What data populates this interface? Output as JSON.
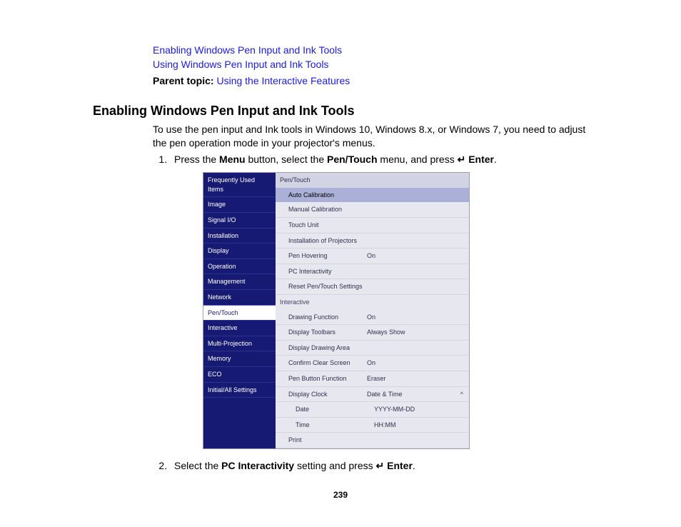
{
  "toc": {
    "link1": "Enabling Windows Pen Input and Ink Tools",
    "link2": "Using Windows Pen Input and Ink Tools",
    "parent_label": "Parent topic:",
    "parent_link": "Using the Interactive Features"
  },
  "section": {
    "title": "Enabling Windows Pen Input and Ink Tools",
    "intro": "To use the pen input and Ink tools in Windows 10, Windows 8.x, or Windows 7, you need to adjust the pen operation mode in your projector's menus."
  },
  "steps": {
    "s1_a": "Press the ",
    "s1_menu": "Menu",
    "s1_b": " button, select the ",
    "s1_pen": "Pen/Touch",
    "s1_c": " menu, and press ",
    "s1_enter": "Enter",
    "s1_d": ".",
    "s2_a": "Select the ",
    "s2_pc": "PC Interactivity",
    "s2_b": " setting and press ",
    "s2_enter": "Enter",
    "s2_c": "."
  },
  "menu": {
    "left": [
      "Frequently Used Items",
      "Image",
      "Signal I/O",
      "Installation",
      "Display",
      "Operation",
      "Management",
      "Network",
      "Pen/Touch",
      "Interactive",
      "Multi-Projection",
      "Memory",
      "ECO",
      "Initial/All Settings"
    ],
    "left_selected": 8,
    "right_header": "Pen/Touch",
    "right_top": [
      {
        "label": "Auto Calibration",
        "val": "",
        "sel": true
      },
      {
        "label": "Manual Calibration",
        "val": ""
      },
      {
        "label": "Touch Unit",
        "val": ""
      },
      {
        "label": "Installation of Projectors",
        "val": ""
      },
      {
        "label": "Pen Hovering",
        "val": "On"
      },
      {
        "label": "PC Interactivity",
        "val": ""
      },
      {
        "label": "Reset Pen/Touch Settings",
        "val": ""
      }
    ],
    "right_group": "Interactive",
    "right_bottom": [
      {
        "label": "Drawing Function",
        "val": "On"
      },
      {
        "label": "Display Toolbars",
        "val": "Always Show"
      },
      {
        "label": "Display Drawing Area",
        "val": ""
      },
      {
        "label": "Confirm Clear Screen",
        "val": "On"
      },
      {
        "label": "Pen Button Function",
        "val": "Eraser"
      },
      {
        "label": "Display Clock",
        "val": "Date & Time",
        "caret": true
      },
      {
        "label": "Date",
        "val": "YYYY-MM-DD",
        "indent": true
      },
      {
        "label": "Time",
        "val": "HH:MM",
        "indent": true
      },
      {
        "label": "Print",
        "val": ""
      }
    ]
  },
  "page_number": "239"
}
